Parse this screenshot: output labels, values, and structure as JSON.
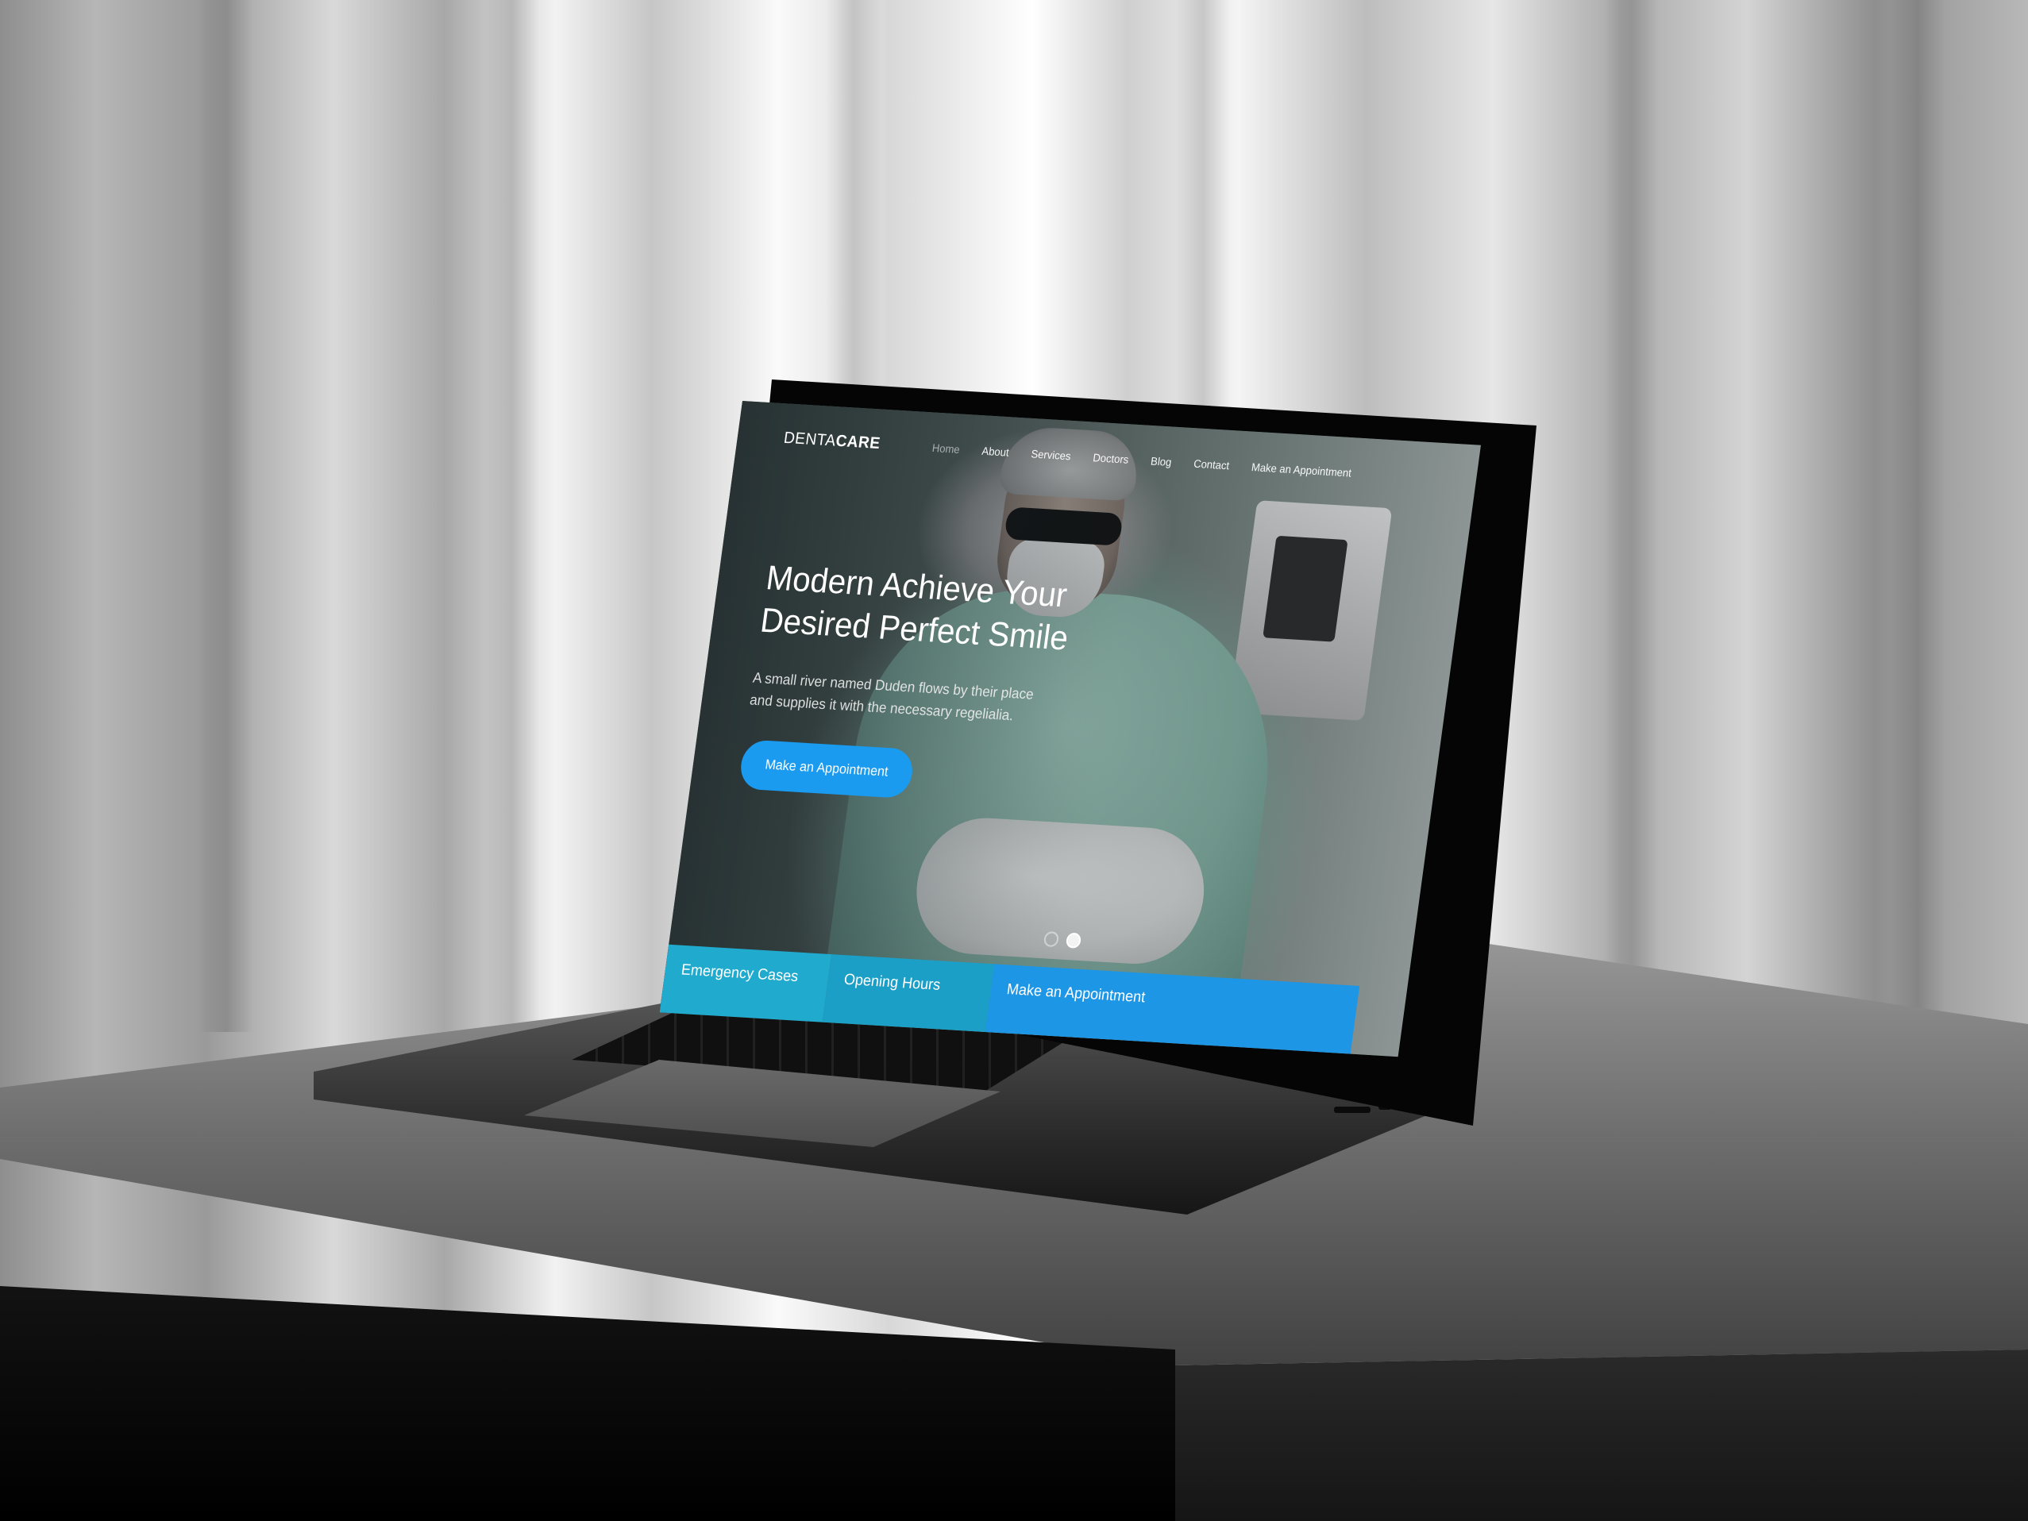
{
  "site": {
    "logo": {
      "light": "DENTA",
      "bold": "CARE"
    },
    "nav": [
      {
        "label": "Home",
        "muted": true
      },
      {
        "label": "About"
      },
      {
        "label": "Services"
      },
      {
        "label": "Doctors"
      },
      {
        "label": "Blog"
      },
      {
        "label": "Contact"
      },
      {
        "label": "Make an Appointment"
      }
    ],
    "hero": {
      "title_line1": "Modern Achieve Your",
      "title_line2": "Desired Perfect Smile",
      "subtitle_line1": "A small river named Duden flows by their place",
      "subtitle_line2": "and supplies it with the necessary regelialia.",
      "button_label": "Make an Appointment"
    },
    "carousel": {
      "slides": 2,
      "active_index": 1
    },
    "info_bar": {
      "emergency": "Emergency Cases",
      "hours": "Opening Hours",
      "appointment": "Make an Appointment"
    }
  },
  "colors": {
    "accent_blue": "#1a9bef",
    "teal": "#20aacd",
    "white": "#ffffff"
  }
}
